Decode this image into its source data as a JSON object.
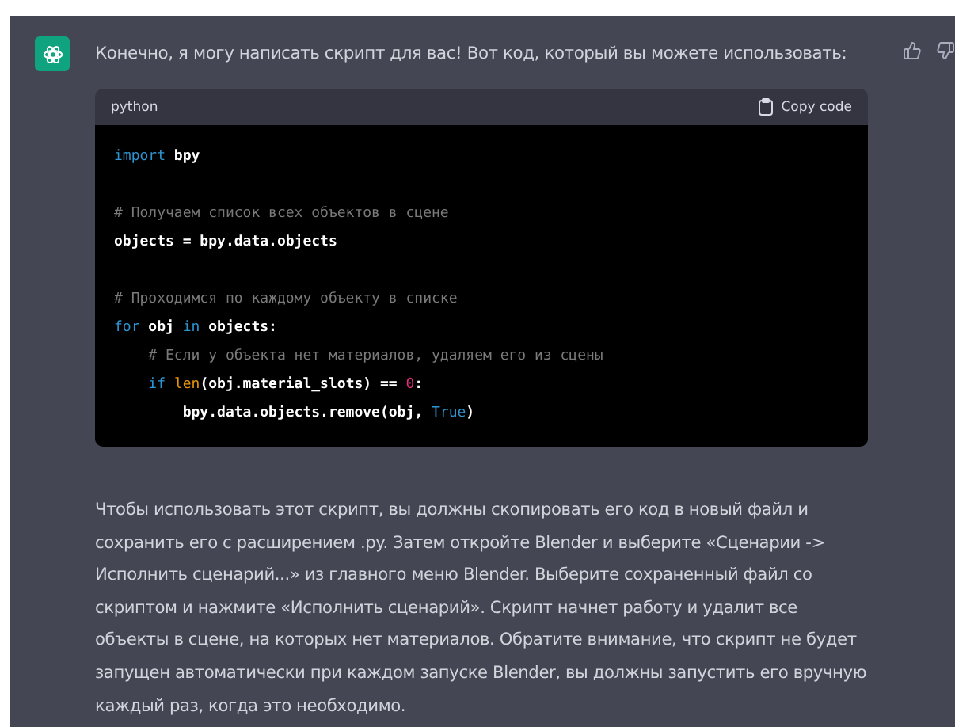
{
  "message": {
    "text": "Конечно, я могу написать скрипт для вас! Вот код, который вы можете использовать:",
    "code": {
      "language": "python",
      "copy_label": "Copy code",
      "lines": [
        {
          "kind": "code",
          "tokens": [
            {
              "kind": "keyword",
              "text": "import"
            },
            {
              "kind": "plain",
              "text": " bpy"
            }
          ]
        },
        {
          "kind": "blank"
        },
        {
          "kind": "code",
          "tokens": [
            {
              "kind": "comment",
              "text": "# Получаем список всех объектов в сцене"
            }
          ]
        },
        {
          "kind": "code",
          "tokens": [
            {
              "kind": "plain",
              "text": "objects = bpy.data.objects"
            }
          ]
        },
        {
          "kind": "blank"
        },
        {
          "kind": "code",
          "tokens": [
            {
              "kind": "comment",
              "text": "# Проходимся по каждому объекту в списке"
            }
          ]
        },
        {
          "kind": "code",
          "tokens": [
            {
              "kind": "keyword",
              "text": "for"
            },
            {
              "kind": "plain",
              "text": " obj "
            },
            {
              "kind": "keyword",
              "text": "in"
            },
            {
              "kind": "plain",
              "text": " objects:"
            }
          ]
        },
        {
          "kind": "code",
          "tokens": [
            {
              "kind": "comment",
              "text": "    # Если у объекта нет материалов, удаляем его из сцены"
            }
          ]
        },
        {
          "kind": "code",
          "tokens": [
            {
              "kind": "keyword",
              "text": "    if "
            },
            {
              "kind": "builtin",
              "text": "len"
            },
            {
              "kind": "plain",
              "text": "(obj.material_slots) == "
            },
            {
              "kind": "number",
              "text": "0"
            },
            {
              "kind": "plain",
              "text": ":"
            }
          ]
        },
        {
          "kind": "code",
          "tokens": [
            {
              "kind": "plain",
              "text": "        bpy.data.objects.remove(obj, "
            },
            {
              "kind": "keyword",
              "text": "True"
            },
            {
              "kind": "plain",
              "text": ")"
            }
          ]
        }
      ]
    },
    "paragraph_lines": [
      "Чтобы использовать этот скрипт, вы должны скопировать его код в новый файл и",
      "сохранить его с расширением .py. Затем откройте Blender и выберите «Сценарии ->",
      "Исполнить сценарий...» из главного меню Blender. Выберите сохраненный файл со",
      "скриптом и нажмите «Исполнить сценарий». Скрипт начнет работу и удалит все",
      "объекты в сцене, на которых нет материалов. Обратите внимание, что скрипт не будет",
      "запущен автоматически при каждом запуске Blender, вы должны запустить его вручную",
      "каждый раз, когда это необходимо."
    ]
  }
}
